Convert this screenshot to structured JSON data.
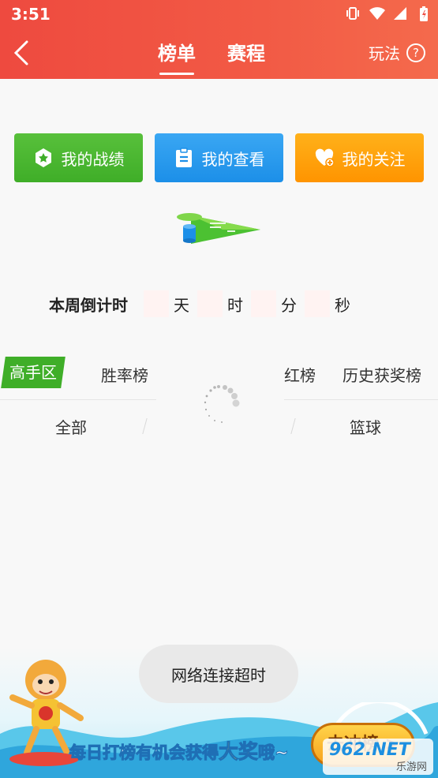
{
  "status_bar": {
    "time": "3:51",
    "icons": [
      "vibrate-icon",
      "wifi-icon",
      "signal-icon",
      "battery-icon"
    ]
  },
  "nav": {
    "back_icon": "chevron-left-icon",
    "tabs": [
      {
        "label": "榜单",
        "active": true
      },
      {
        "label": "赛程",
        "active": false
      }
    ],
    "rules_label": "玩法",
    "rules_icon_glyph": "?"
  },
  "actions": [
    {
      "label": "我的战绩",
      "icon": "medal-icon",
      "color": "#3fae28"
    },
    {
      "label": "我的查看",
      "icon": "clipboard-icon",
      "color": "#1c8fe8"
    },
    {
      "label": "我的关注",
      "icon": "heart-plus-icon",
      "color": "#ff9400"
    }
  ],
  "countdown": {
    "label": "本周倒计时",
    "units": [
      "天",
      "时",
      "分",
      "秒"
    ]
  },
  "rank_tabs": [
    "高手区",
    "胜率榜",
    "红榜",
    "历史获奖榜"
  ],
  "sport_filters": [
    "全部",
    "篮球"
  ],
  "toast": "网络连接超时",
  "banner": {
    "slogan_prefix": "每日打榜有机会获得",
    "slogan_emphasis": "大奖",
    "slogan_suffix": "哦~",
    "cta_label": "去冲榜 >"
  },
  "watermark": {
    "brand": "962.NET",
    "sub": "乐游网"
  },
  "colors": {
    "header": "#ee4a3f",
    "green": "#3fae28",
    "blue": "#1c8fe8",
    "orange": "#ff9400"
  }
}
